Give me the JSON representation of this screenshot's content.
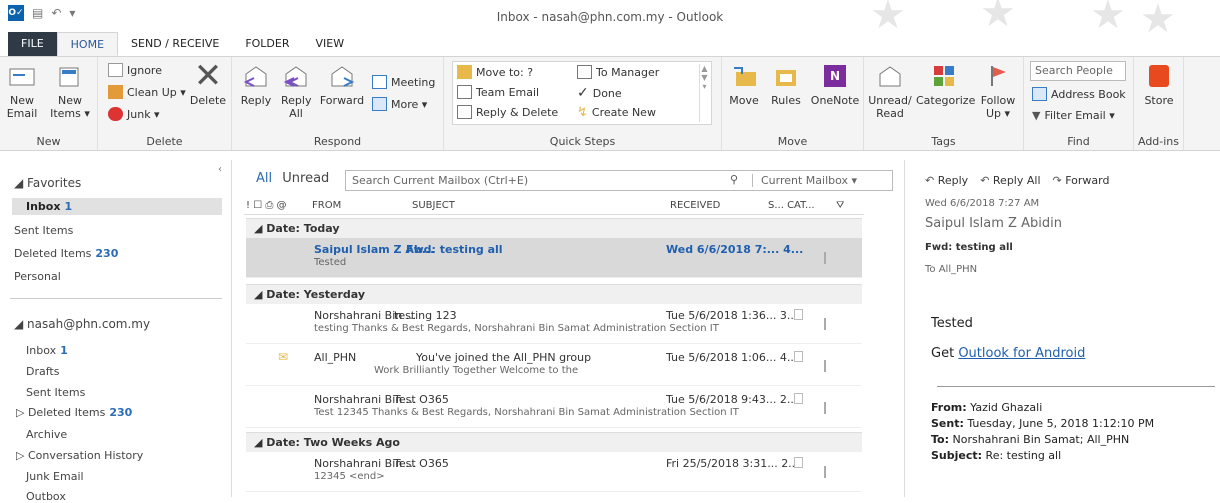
{
  "window": {
    "title": "Inbox - nasah@phn.com.my - Outlook",
    "app_icon": "O✓"
  },
  "tabs": [
    "FILE",
    "HOME",
    "SEND / RECEIVE",
    "FOLDER",
    "VIEW"
  ],
  "ribbon": {
    "new": {
      "new_email": "New Email",
      "new_items": "New Items ▾",
      "group": "New"
    },
    "delete": {
      "ignore": "Ignore",
      "cleanup": "Clean Up ▾",
      "junk": "Junk ▾",
      "delete": "Delete",
      "group": "Delete"
    },
    "respond": {
      "reply": "Reply",
      "reply_all": "Reply All",
      "forward": "Forward",
      "meeting": "Meeting",
      "more": "More ▾",
      "group": "Respond"
    },
    "quicksteps": {
      "moveto": "Move to: ?",
      "team": "Team Email",
      "replydel": "Reply & Delete",
      "tomanager": "To Manager",
      "done": "Done",
      "create": "Create New",
      "group": "Quick Steps"
    },
    "move": {
      "move": "Move",
      "rules": "Rules",
      "onenote": "OneNote",
      "group": "Move"
    },
    "tags": {
      "unread": "Unread/ Read",
      "categorize": "Categorize",
      "follow": "Follow Up ▾",
      "group": "Tags"
    },
    "find": {
      "search_people": "Search People",
      "address": "Address Book",
      "filter": "Filter Email ▾",
      "group": "Find"
    },
    "addins": {
      "store": "Store",
      "group": "Add-ins"
    }
  },
  "nav": {
    "favorites": "◢ Favorites",
    "fav_items": [
      {
        "label": "Inbox",
        "count": "1"
      },
      {
        "label": "Sent Items",
        "count": ""
      },
      {
        "label": "Deleted Items",
        "count": "230"
      },
      {
        "label": "Personal",
        "count": ""
      }
    ],
    "account": "◢ nasah@phn.com.my",
    "acc_items": [
      {
        "label": "Inbox",
        "count": "1"
      },
      {
        "label": "Drafts",
        "count": ""
      },
      {
        "label": "Sent Items",
        "count": ""
      },
      {
        "label": "▷ Deleted Items",
        "count": "230"
      },
      {
        "label": "Archive",
        "count": ""
      },
      {
        "label": "▷ Conversation History",
        "count": ""
      },
      {
        "label": "Junk Email",
        "count": ""
      },
      {
        "label": "Outbox",
        "count": ""
      }
    ]
  },
  "list": {
    "all": "All",
    "unread": "Unread",
    "search_placeholder": "Search Current Mailbox (Ctrl+E)",
    "scope": "Current Mailbox ▾",
    "cols": {
      "icons": "! ☐ ⎙ @",
      "from": "FROM",
      "subject": "SUBJECT",
      "received": "RECEIVED",
      "size": "S... CAT...",
      "flag": "⛛"
    },
    "groups": [
      "◢ Date: Today",
      "◢ Date: Yesterday",
      "◢ Date: Two Weeks Ago"
    ],
    "messages": [
      {
        "from": "Saipul Islam Z Ab...",
        "subject": "Fwd: testing all",
        "received": "Wed 6/6/2018 7:...  4...",
        "preview": "Tested"
      },
      {
        "from": "Norshahrani Bin ...",
        "subject": "testing 123",
        "received": "Tue 5/6/2018 1:36...  3...",
        "preview": "testing  Thanks & Best Regards,  Norshahrani Bin Samat  Administration Section  IT"
      },
      {
        "from": "All_PHN",
        "subject": "You've joined the All_PHN group",
        "received": "Tue 5/6/2018 1:06...  4...",
        "preview": "Work Brilliantly Together      Welcome to the"
      },
      {
        "from": "Norshahrani Bin ...",
        "subject": "Test O365",
        "received": "Tue 5/6/2018 9:43...  2...",
        "preview": "Test 12345  Thanks & Best Regards,  Norshahrani Bin Samat  Administration Section  IT"
      },
      {
        "from": "Norshahrani Bin ...",
        "subject": "Test O365",
        "received": "Fri 25/5/2018 3:31...  2...",
        "preview": "12345 <end>"
      }
    ]
  },
  "reading": {
    "reply": "Reply",
    "reply_all": "Reply All",
    "forward": "Forward",
    "date": "Wed 6/6/2018 7:27 AM",
    "sender": "Saipul Islam Z Abidin",
    "subject": "Fwd: testing all",
    "to": "To   All_PHN",
    "body1": "Tested",
    "body2_pre": "Get ",
    "body2_link": "Outlook for Android",
    "from_l": "From:",
    "from_v": " Yazid Ghazali",
    "sent_l": "Sent:",
    "sent_v": " Tuesday, June 5, 2018 1:12:10 PM",
    "to_l": "To:",
    "to_v": " Norshahrani Bin Samat; All_PHN",
    "subj_l": "Subject:",
    "subj_v": " Re: testing all"
  }
}
